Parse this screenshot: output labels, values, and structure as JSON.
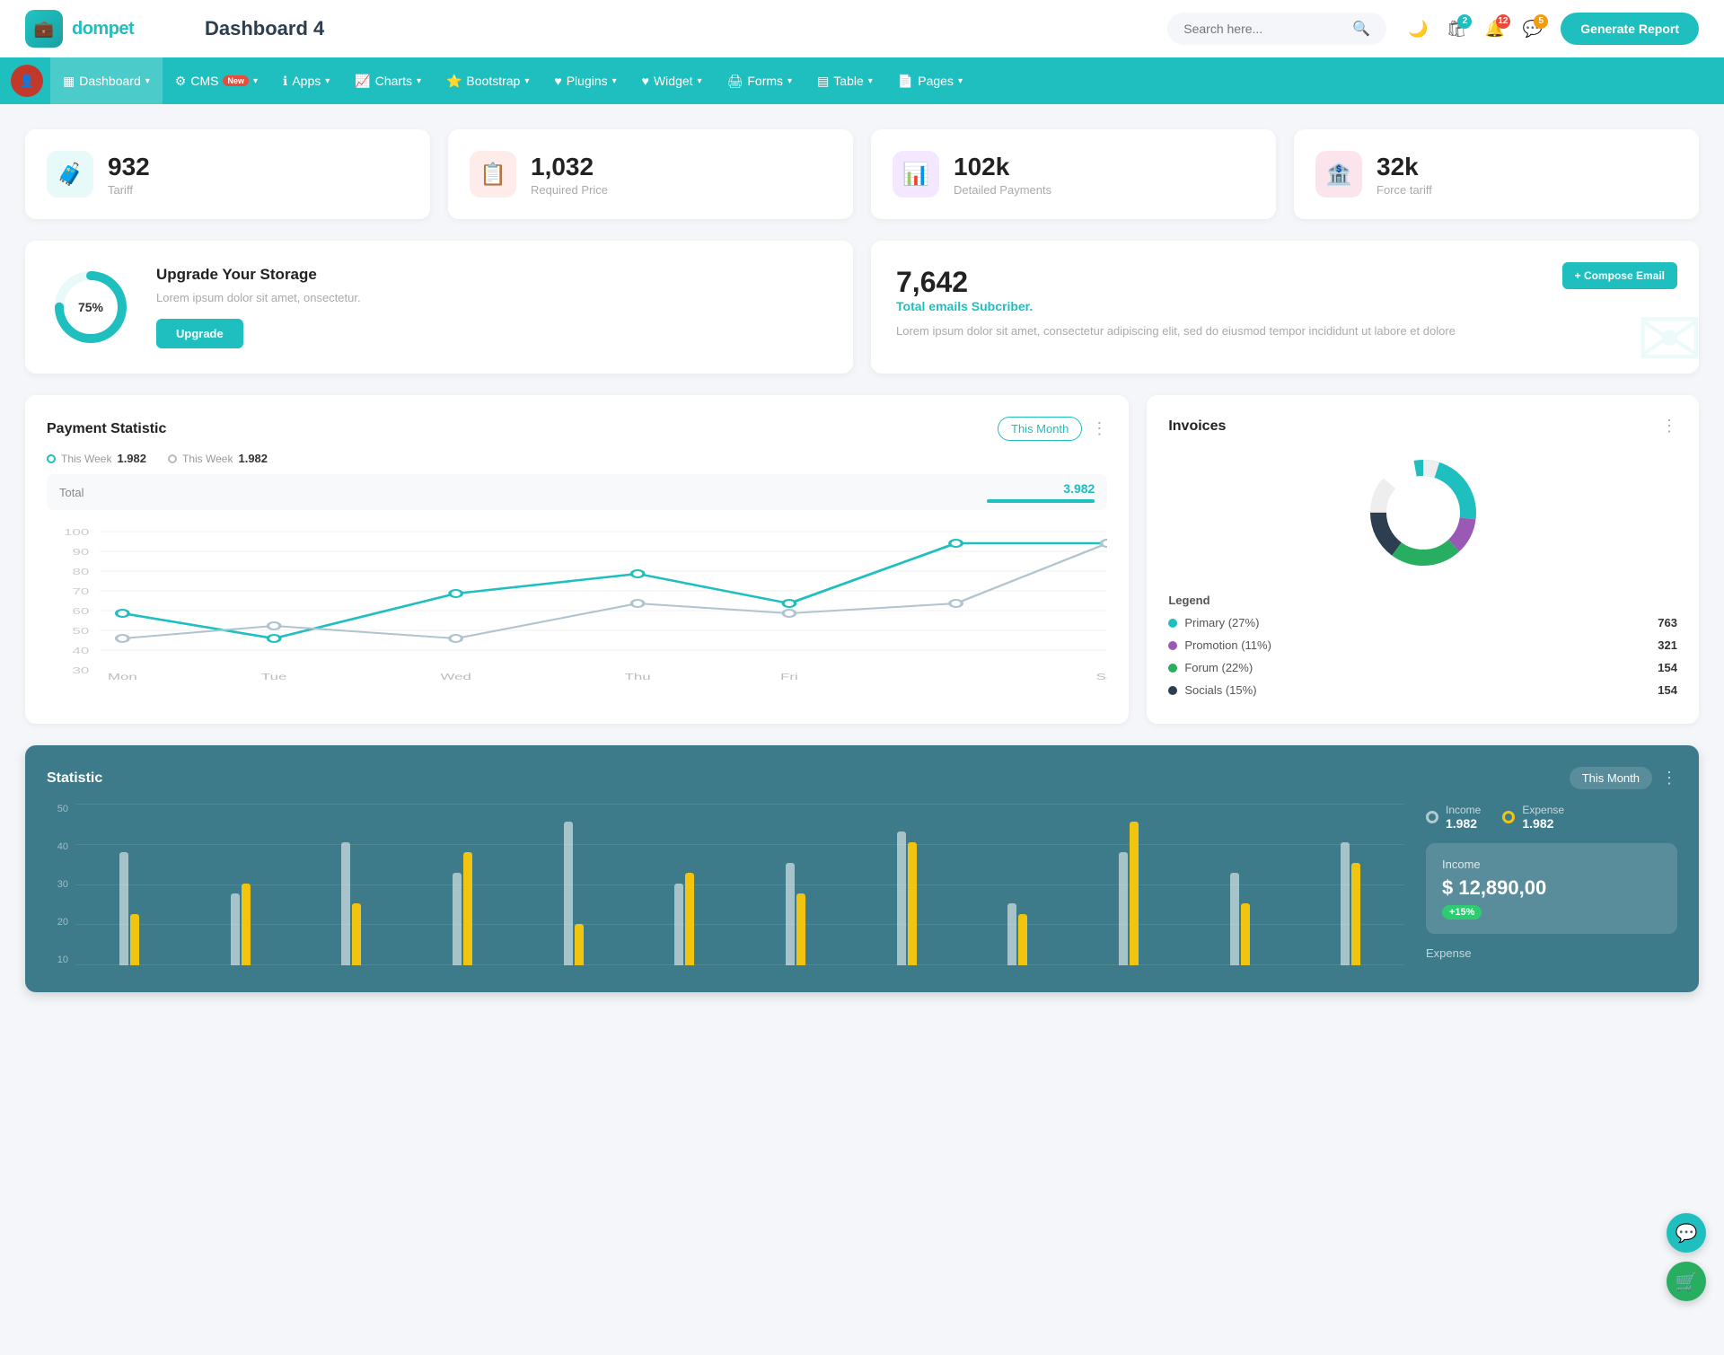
{
  "header": {
    "logo_icon": "💼",
    "logo_text": "dompet",
    "page_title": "Dashboard 4",
    "search_placeholder": "Search here...",
    "generate_btn": "Generate Report",
    "icons": {
      "theme": "🌙",
      "shop": "🛍",
      "bell_badge": "2",
      "chat_badge": "12",
      "msg_badge": "5"
    }
  },
  "nav": {
    "items": [
      {
        "label": "Dashboard",
        "icon": "▦",
        "active": true,
        "has_dropdown": true
      },
      {
        "label": "CMS",
        "icon": "⚙",
        "is_new": true,
        "has_dropdown": true
      },
      {
        "label": "Apps",
        "icon": "ℹ",
        "has_dropdown": true
      },
      {
        "label": "Charts",
        "icon": "📈",
        "has_dropdown": true
      },
      {
        "label": "Bootstrap",
        "icon": "⭐",
        "has_dropdown": true
      },
      {
        "label": "Plugins",
        "icon": "♥",
        "has_dropdown": true
      },
      {
        "label": "Widget",
        "icon": "♥",
        "has_dropdown": true
      },
      {
        "label": "Forms",
        "icon": "🖨",
        "has_dropdown": true
      },
      {
        "label": "Table",
        "icon": "▤",
        "has_dropdown": true
      },
      {
        "label": "Pages",
        "icon": "📄",
        "has_dropdown": true
      }
    ]
  },
  "stat_cards": [
    {
      "value": "932",
      "label": "Tariff",
      "icon_color": "teal"
    },
    {
      "value": "1,032",
      "label": "Required Price",
      "icon_color": "red"
    },
    {
      "value": "102k",
      "label": "Detailed Payments",
      "icon_color": "purple"
    },
    {
      "value": "32k",
      "label": "Force tariff",
      "icon_color": "pink"
    }
  ],
  "storage": {
    "percent": "75%",
    "title": "Upgrade Your Storage",
    "desc": "Lorem ipsum dolor sit amet, onsectetur.",
    "btn_label": "Upgrade"
  },
  "email": {
    "count": "7,642",
    "subtitle": "Total emails Subcriber.",
    "desc": "Lorem ipsum dolor sit amet, consectetur adipiscing elit, sed do eiusmod tempor incididunt ut labore et dolore",
    "compose_btn": "+ Compose Email"
  },
  "payment": {
    "title": "Payment Statistic",
    "this_month_btn": "This Month",
    "legend": [
      {
        "label": "This Week",
        "value": "1.982",
        "color": "teal"
      },
      {
        "label": "This Week",
        "value": "1.982",
        "color": "gray"
      }
    ],
    "total_label": "Total",
    "total_value": "3.982",
    "x_labels": [
      "Mon",
      "Tue",
      "Wed",
      "Thu",
      "Fri",
      "Sat"
    ],
    "y_labels": [
      "100",
      "90",
      "80",
      "70",
      "60",
      "50",
      "40",
      "30"
    ],
    "line1": [
      60,
      40,
      70,
      80,
      65,
      90,
      90
    ],
    "line2": [
      40,
      50,
      40,
      65,
      60,
      65,
      90
    ]
  },
  "invoices": {
    "title": "Invoices",
    "legend": [
      {
        "label": "Primary (27%)",
        "count": "763",
        "color": "#20bfbf"
      },
      {
        "label": "Promotion (11%)",
        "count": "321",
        "color": "#9b59b6"
      },
      {
        "label": "Forum (22%)",
        "count": "154",
        "color": "#27ae60"
      },
      {
        "label": "Socials (15%)",
        "count": "154",
        "color": "#333"
      }
    ]
  },
  "statistic": {
    "title": "Statistic",
    "this_month_btn": "This Month",
    "y_labels": [
      "50",
      "40",
      "30",
      "20",
      "10"
    ],
    "income_legend": "Income",
    "income_value": "1.982",
    "expense_legend": "Expense",
    "expense_value": "1.982",
    "income_label": "Income",
    "income_amount": "$ 12,890,00",
    "income_change": "+15%",
    "expense_label": "Expense",
    "bars": [
      {
        "white": 55,
        "yellow": 25
      },
      {
        "white": 35,
        "yellow": 40
      },
      {
        "white": 60,
        "yellow": 30
      },
      {
        "white": 45,
        "yellow": 55
      },
      {
        "white": 70,
        "yellow": 20
      },
      {
        "white": 40,
        "yellow": 45
      },
      {
        "white": 50,
        "yellow": 35
      },
      {
        "white": 65,
        "yellow": 60
      },
      {
        "white": 30,
        "yellow": 25
      },
      {
        "white": 55,
        "yellow": 70
      },
      {
        "white": 45,
        "yellow": 30
      },
      {
        "white": 60,
        "yellow": 50
      }
    ]
  }
}
